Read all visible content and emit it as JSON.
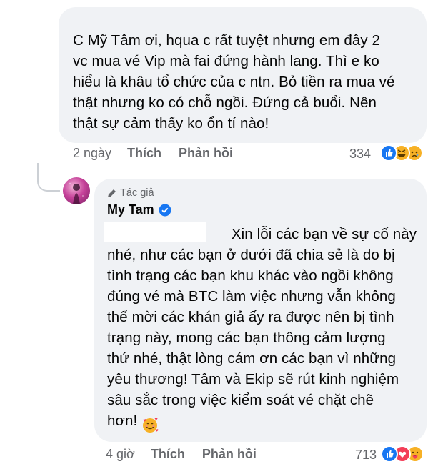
{
  "comment1": {
    "text": "C Mỹ Tâm ơi, hqua c rất tuyệt nhưng em đây 2\nvc mua vé Vip mà fai đứng hành lang. Thì e ko\nhiểu là khâu tổ chức của c ntn. Bỏ tiền ra mua vé\nthật nhưng ko có chỗ ngồi. Đứng cả buổi. Nên\nthật sự cảm thấy ko ổn tí nào!",
    "time": "2 ngày",
    "like_label": "Thích",
    "reply_label": "Phản hồi",
    "reaction_count": "334",
    "reactions": [
      "like-icon",
      "haha-icon",
      "sad-icon"
    ]
  },
  "reply": {
    "badge": "Tác giả",
    "author": "My Tam",
    "text": "                              Xin lỗi các bạn về sự cố này\nnhé, như các bạn ở dưới đã chia sẻ là do bị\ntình trạng các bạn khu khác vào ngồi không\nđúng vé mà BTC làm việc nhưng vẫn không\nthể mời các khán giả ấy ra được nên bị tình\ntrạng này, mong các bạn thông cảm lượng\nthứ nhé, thật lòng cám ơn các bạn vì những\nyêu thương! Tâm và Ekip sẽ rút kinh nghiệm\nsâu sắc trong việc kiểm soát vé chặt chẽ\nhơn!",
    "time": "4 giờ",
    "like_label": "Thích",
    "reply_label": "Phản hồi",
    "reaction_count": "713",
    "reactions": [
      "like-icon",
      "love-icon",
      "care-icon"
    ]
  },
  "colors": {
    "bubble": "#f0f2f5",
    "secondary_text": "#65676b",
    "like_blue": "#1877f2",
    "love_red": "#f33e58",
    "emoji_yellow": "#f7b125"
  }
}
